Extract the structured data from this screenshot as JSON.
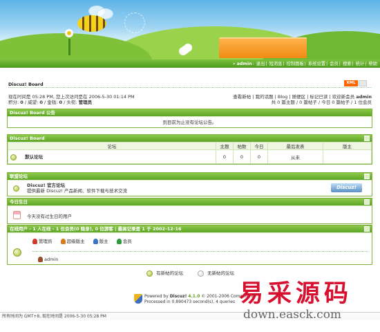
{
  "nav": {
    "items": [
      {
        "label": "admin",
        "bold": true
      },
      {
        "label": "退出"
      },
      {
        "label": "短消息"
      },
      {
        "label": "控制面板"
      },
      {
        "label": "系统设置"
      },
      {
        "label": "会员"
      },
      {
        "label": "搜索"
      },
      {
        "label": "统计"
      },
      {
        "label": "帮助"
      }
    ]
  },
  "board": {
    "title": "Discuz! Board",
    "xml_badge": "XML"
  },
  "info": {
    "time_line": "现在时间是  05:28 PM, 您上次访问是在  2006-5-30 01:14 PM",
    "points_prefix": "积分: ",
    "points_val": "0",
    "prestige_label": " / 威望: ",
    "prestige_val": "0",
    "money_label": " / 金钱: ",
    "money_val": "0",
    "title_label": " / 头衔: ",
    "title_val": "管理员",
    "right_links": "查看新帖 | 我的话题 | Blog | 随便区 | 标记已读 | 欢迎新会员",
    "newest_member": "admin",
    "stats_line": "共 0 篇主题 / 0 篇帖子 / 今日 0 篇帖子 / 1 位会员"
  },
  "announce": {
    "title": "Discuz! Board 公告",
    "text": "到目前为止没有论坛公告。"
  },
  "forums": {
    "title": "Discuz! Board",
    "headers": [
      "论坛",
      "主题",
      "帖数",
      "今日",
      "最后发表",
      "版主"
    ],
    "rows": [
      {
        "name": "默认论坛",
        "threads": "0",
        "posts": "0",
        "today": "0",
        "last": "从未",
        "mods": ""
      }
    ]
  },
  "links": {
    "title": "联盟论坛",
    "name": "Discuz! 官方论坛",
    "desc": "提供最新 Discuz! 产品新闻、软件下载与技术交流",
    "logo": "Discuz!"
  },
  "birthday": {
    "title": "今日生日",
    "text": "今天没有过生日的用户"
  },
  "online": {
    "title": "在线用户 - 1 人在线 - 1 位会员(0 隐身), 0 位游客 | 最高记录是 1 于 2002-12-16",
    "groups": [
      {
        "label": "管理员",
        "icon": "admin-user-icon"
      },
      {
        "label": "超级版主",
        "icon": "supermod-user-icon"
      },
      {
        "label": "版主",
        "icon": "mod-user-icon"
      },
      {
        "label": "会员",
        "icon": "member-user-icon"
      }
    ],
    "users": [
      "admin"
    ]
  },
  "legend": {
    "new": "有新帖的论坛",
    "none": "无新帖的论坛"
  },
  "footer": {
    "powered_prefix": "Powered by ",
    "powered_name": "Discuz!",
    "version": "4.1.0",
    "copyright": "© 2001-2006 Comsenz In",
    "processed": "Processed in 0.890473 second(s), 4 queries"
  },
  "bottom": {
    "timezone": "所有时间为  GMT+8, 现在时间是  2006-5-30 05:28 PM"
  },
  "watermark": {
    "cn": "易采源码",
    "url": "down.easck.com"
  }
}
